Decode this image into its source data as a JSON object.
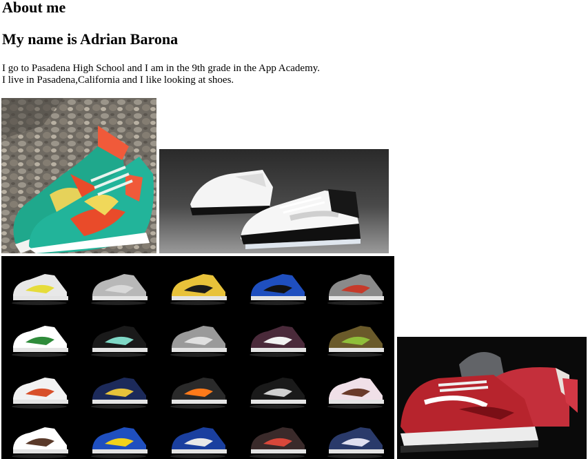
{
  "page": {
    "heading": "About me",
    "name_heading": "My name is Adrian Barona",
    "intro_line1": "I go to Pasadena High School and I am in the 9th grade in the App Academy.",
    "intro_line2": "I live in Pasadena,California and I like looking at shoes."
  },
  "images": {
    "green_dunk": {
      "alt": "green floral sneakers on rocks"
    },
    "concord": {
      "alt": "black and white sneakers"
    },
    "grid": {
      "alt": "grid of dunk sneakers"
    },
    "lobster": {
      "alt": "red lobster dunk sneakers"
    }
  },
  "colors": {
    "grid_background": "#000000",
    "green_shoe": "#1fa88c",
    "red_shoe": "#b4242c"
  }
}
